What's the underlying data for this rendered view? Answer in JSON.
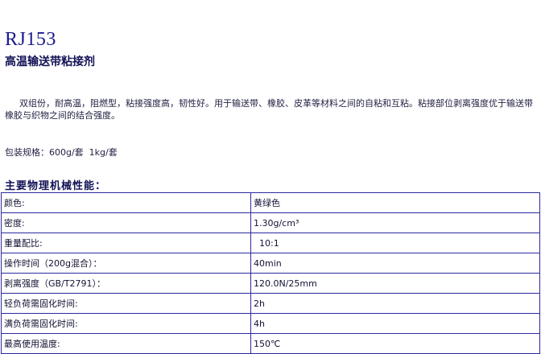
{
  "product": {
    "code": "RJ153",
    "name": "高温输送带粘接剂"
  },
  "description": "双组份，耐高温，阻燃型，粘接强度高，韧性好。用于输送带、橡胶、皮革等材料之间的自粘和互粘。粘接部位剥离强度优于输送带橡胶与织物之间的结合强度。",
  "packaging": "包装规格：600g/套  1kg/套",
  "properties_title": "主要物理机械性能：",
  "properties": [
    {
      "label": "颜色:",
      "value": "黄绿色"
    },
    {
      "label": "密度:",
      "value": "1.30g/cm³"
    },
    {
      "label": "重量配比:",
      "value": "  10:1"
    },
    {
      "label": "操作时间（200g混合）：",
      "value": "40min"
    },
    {
      "label": "剥离强度（GB/T2791）：",
      "value": "120.0N/25mm"
    },
    {
      "label": "轻负荷需固化时间:",
      "value": "2h"
    },
    {
      "label": "满负荷需固化时间:",
      "value": "4h"
    },
    {
      "label": "最高使用温度:",
      "value": "150℃"
    }
  ]
}
